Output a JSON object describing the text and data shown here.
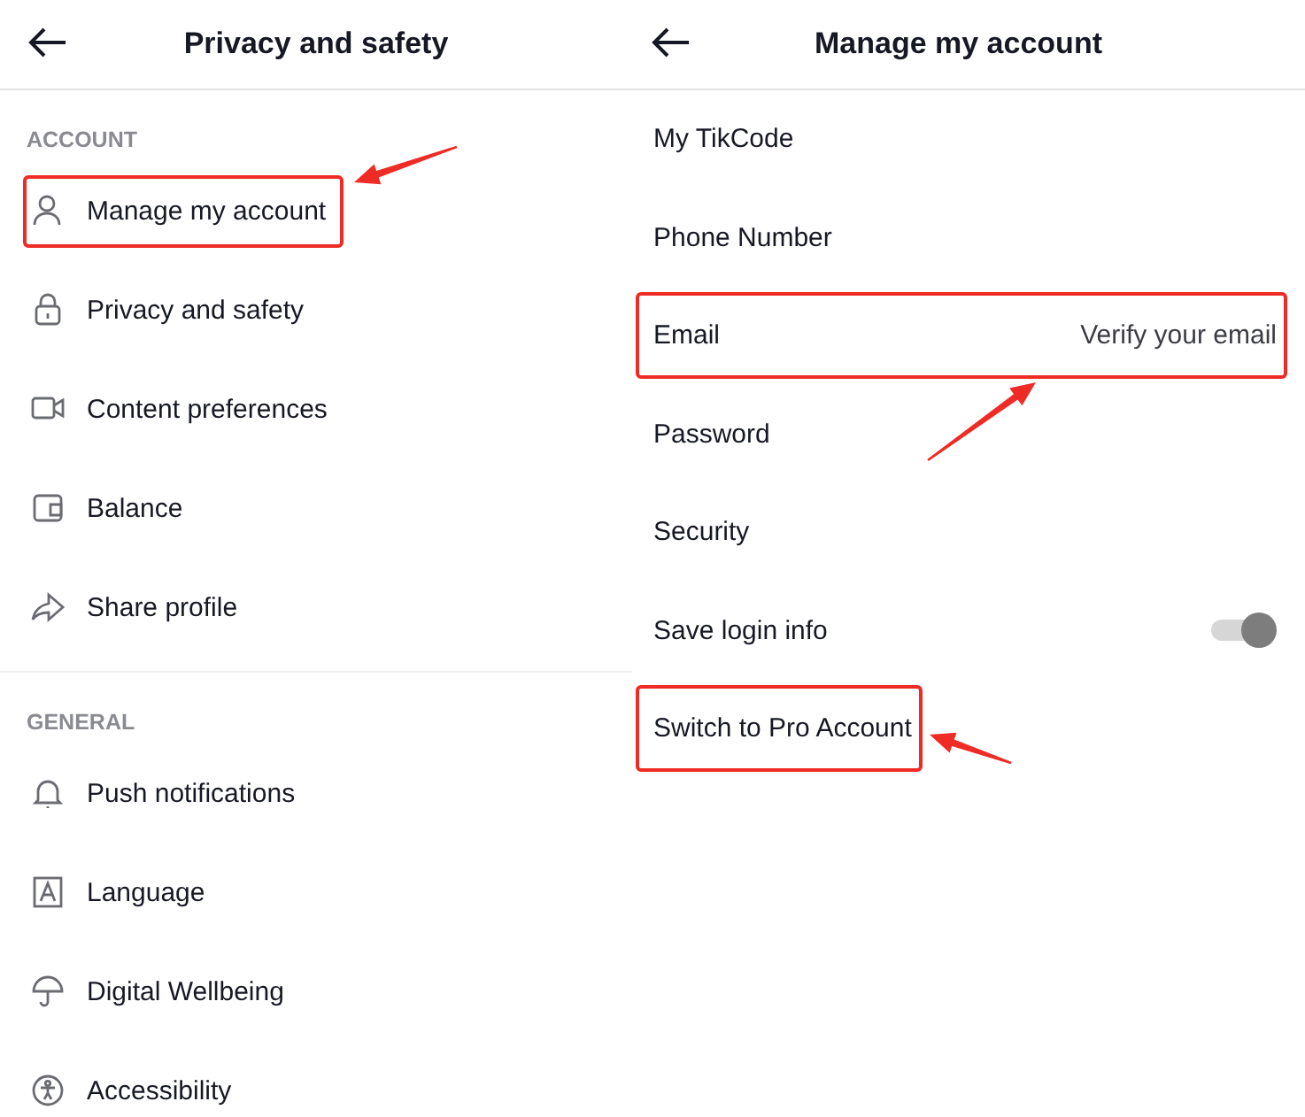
{
  "left_panel": {
    "title": "Privacy and safety",
    "sections": [
      {
        "label": "ACCOUNT",
        "items": [
          {
            "label": "Manage my account",
            "highlighted": true
          },
          {
            "label": "Privacy and safety",
            "highlighted": false
          },
          {
            "label": "Content preferences",
            "highlighted": false
          },
          {
            "label": "Balance",
            "highlighted": false
          },
          {
            "label": "Share profile",
            "highlighted": false
          }
        ]
      },
      {
        "label": "GENERAL",
        "items": [
          {
            "label": "Push notifications",
            "highlighted": false
          },
          {
            "label": "Language",
            "highlighted": false
          },
          {
            "label": "Digital Wellbeing",
            "highlighted": false
          },
          {
            "label": "Accessibility",
            "highlighted": false
          }
        ]
      }
    ]
  },
  "right_panel": {
    "title": "Manage my account",
    "items": [
      {
        "kind": "link",
        "label": "My TikCode",
        "highlighted": false
      },
      {
        "kind": "link",
        "label": "Phone Number",
        "highlighted": false
      },
      {
        "kind": "value",
        "label": "Email",
        "value": "Verify your email",
        "highlighted": true
      },
      {
        "kind": "link",
        "label": "Password",
        "highlighted": false
      },
      {
        "kind": "link",
        "label": "Security",
        "highlighted": false
      },
      {
        "kind": "toggle",
        "label": "Save login info",
        "on": true,
        "highlighted": false
      },
      {
        "kind": "link",
        "label": "Switch to Pro Account",
        "highlighted": true
      }
    ]
  }
}
